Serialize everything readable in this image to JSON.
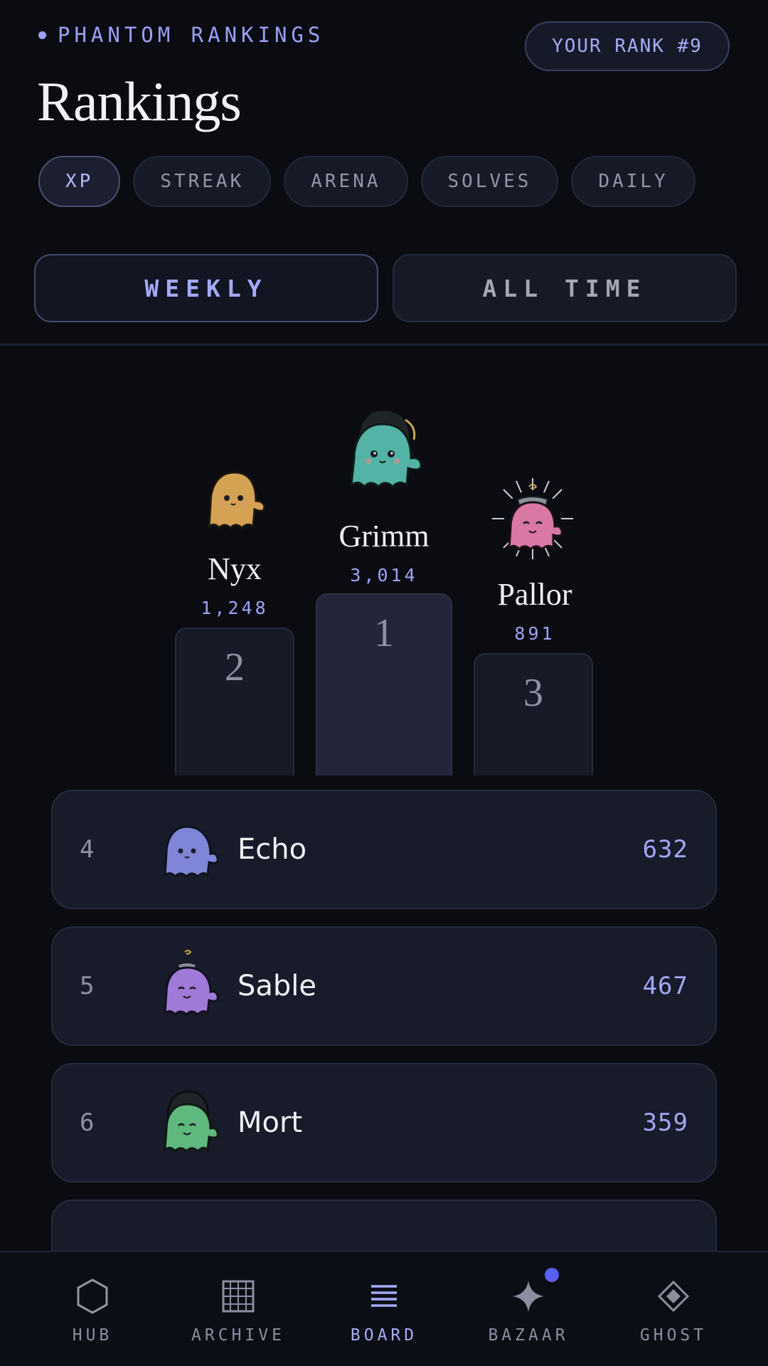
{
  "header": {
    "eyebrow": "PHANTOM RANKINGS",
    "your_rank": "YOUR RANK #9",
    "title": "Rankings"
  },
  "categories": [
    {
      "label": "XP",
      "active": true
    },
    {
      "label": "STREAK",
      "active": false
    },
    {
      "label": "ARENA",
      "active": false
    },
    {
      "label": "SOLVES",
      "active": false
    },
    {
      "label": "DAILY",
      "active": false
    }
  ],
  "period": {
    "weekly": "WEEKLY",
    "all_time": "ALL TIME",
    "selected": "WEEKLY"
  },
  "podium": {
    "first": {
      "place": "1",
      "name": "Grimm",
      "score": "3,014",
      "avatar_color": "#52b3a6",
      "accessory": "hood"
    },
    "second": {
      "place": "2",
      "name": "Nyx",
      "score": "1,248",
      "avatar_color": "#d4a253",
      "accessory": "none"
    },
    "third": {
      "place": "3",
      "name": "Pallor",
      "score": "891",
      "avatar_color": "#d978a4",
      "accessory": "crown"
    }
  },
  "list": [
    {
      "rank": "4",
      "name": "Echo",
      "score": "632",
      "avatar_color": "#7f86d8"
    },
    {
      "rank": "5",
      "name": "Sable",
      "score": "467",
      "avatar_color": "#a07ad8"
    },
    {
      "rank": "6",
      "name": "Mort",
      "score": "359",
      "avatar_color": "#5fb87e"
    }
  ],
  "nav": [
    {
      "label": "HUB",
      "icon": "hexagon-icon",
      "glyph": "⬡"
    },
    {
      "label": "ARCHIVE",
      "icon": "grid-icon",
      "glyph": "▦"
    },
    {
      "label": "BOARD",
      "icon": "list-icon",
      "glyph": "≣",
      "active": true
    },
    {
      "label": "BAZAAR",
      "icon": "sparkle-icon",
      "glyph": "✦"
    },
    {
      "label": "GHOST",
      "icon": "diamond-icon",
      "glyph": "◈"
    }
  ],
  "colors": {
    "accent": "#9aa0f5",
    "background": "#0a0c12",
    "card": "#171b2a",
    "badge": "#5b5ff0"
  }
}
